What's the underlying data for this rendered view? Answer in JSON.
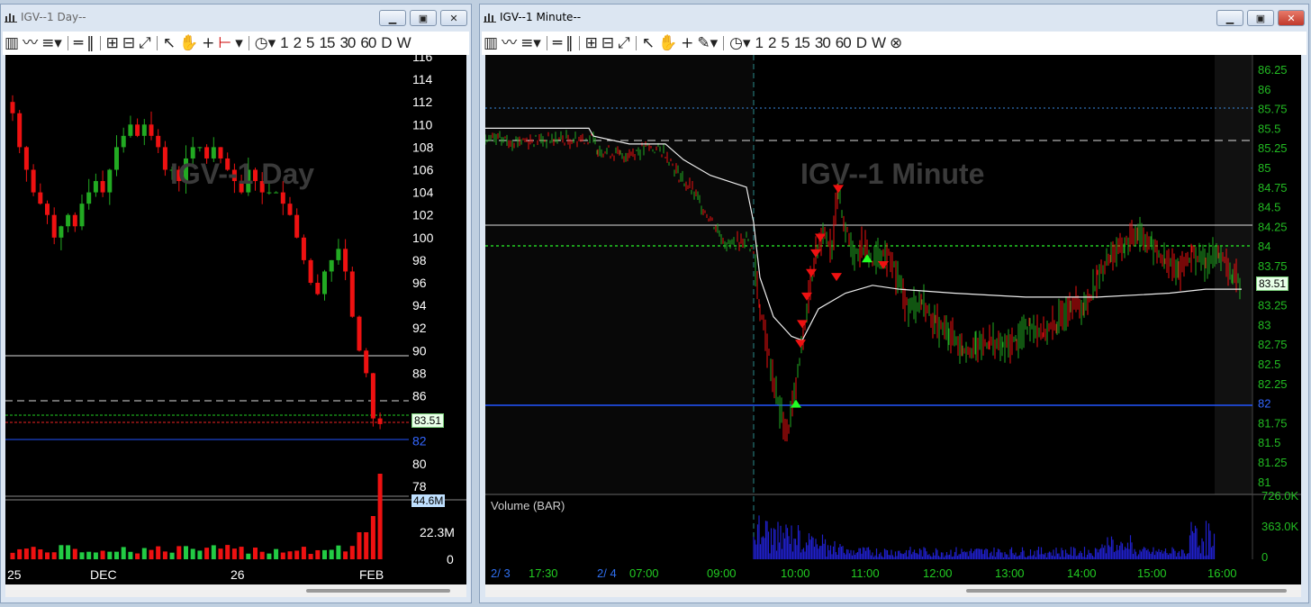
{
  "left": {
    "title": "IGV--1 Day--",
    "watermark": "IGV--1 Day",
    "last_price": "83.51",
    "volume_tag": "44.6M",
    "vol_mid": "22.3M",
    "vol_zero": "0",
    "price_ticks": [
      "116",
      "114",
      "112",
      "110",
      "108",
      "106",
      "104",
      "102",
      "100",
      "98",
      "96",
      "94",
      "92",
      "90",
      "88",
      "86",
      "84",
      "82",
      "80",
      "78"
    ],
    "x_ticks": [
      "25",
      "DEC",
      "26",
      "FEB"
    ],
    "toolbar_numbers": [
      "1",
      "2",
      "5",
      "15",
      "30",
      "60",
      "D",
      "W"
    ]
  },
  "right": {
    "title": "IGV--1 Minute--",
    "watermark": "IGV--1 Minute",
    "last_price": "83.51",
    "volume_label": "Volume (BAR)",
    "vol_ticks": [
      "726.0K",
      "363.0K",
      "0"
    ],
    "price_ticks": [
      "86.25",
      "86",
      "85.75",
      "85.5",
      "85.25",
      "85",
      "84.75",
      "84.5",
      "84.25",
      "84",
      "83.75",
      "83.5",
      "83.25",
      "83",
      "82.75",
      "82.5",
      "82.25",
      "82",
      "81.75",
      "81.5",
      "81.25",
      "81"
    ],
    "x_ticks": [
      "2/ 3",
      "17:30",
      "2/ 4",
      "07:00",
      "09:00",
      "10:00",
      "11:00",
      "12:00",
      "13:00",
      "14:00",
      "15:00",
      "16:00"
    ],
    "toolbar_numbers": [
      "1",
      "2",
      "5",
      "15",
      "30",
      "60",
      "D",
      "W"
    ]
  },
  "colors": {
    "up": "#22aa22",
    "down": "#ee1111",
    "axis_green": "#22bb22",
    "blue_line": "#2255ff",
    "volume_blue": "#2020cc"
  }
}
